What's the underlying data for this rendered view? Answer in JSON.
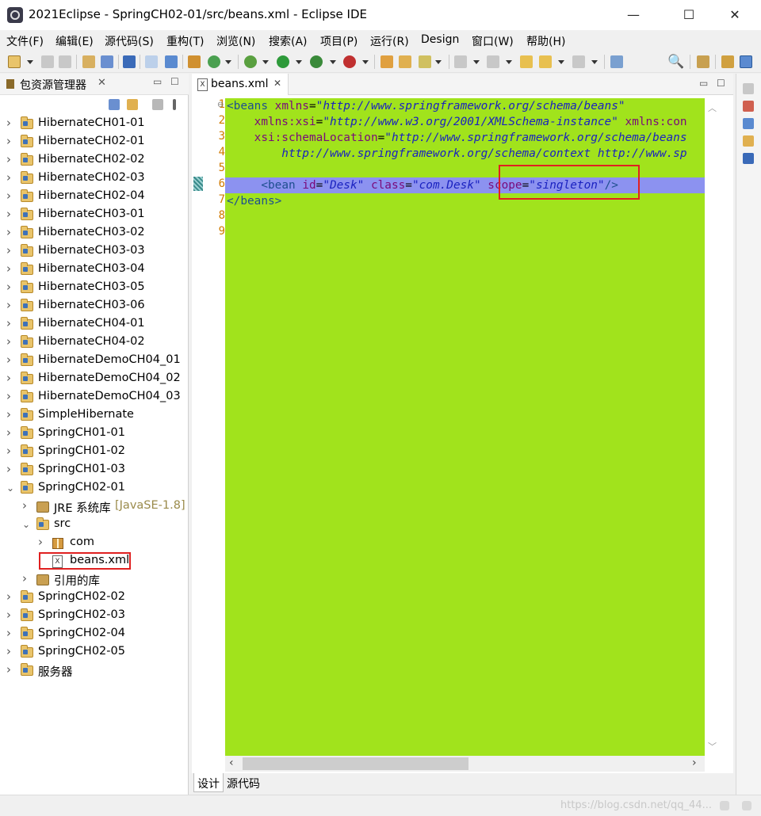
{
  "window": {
    "title": "2021Eclipse - SpringCH02-01/src/beans.xml - Eclipse IDE",
    "minimize": "—",
    "maximize": "☐",
    "close": "✕"
  },
  "menu": [
    "文件(F)",
    "编辑(E)",
    "源代码(S)",
    "重构(T)",
    "浏览(N)",
    "搜索(A)",
    "项目(P)",
    "运行(R)",
    "Design",
    "窗口(W)",
    "帮助(H)"
  ],
  "toolbar": {
    "icons": [
      "new-icon",
      "save-icon",
      "save-all-icon",
      "properties-icon",
      "console-icon",
      "skip-breakpoints-icon",
      "open-task-icon",
      "build-icon",
      "refresh-icon",
      "debug-icon",
      "run-icon",
      "coverage-icon",
      "external-tools-icon",
      "new-java-project-icon",
      "open-type-icon",
      "search-icon",
      "next-annotation-icon",
      "prev-annotation-icon",
      "last-edit-icon",
      "back-icon",
      "forward-icon",
      "pin-icon"
    ],
    "search_glyph": "🔍"
  },
  "explorer": {
    "title": "包资源管理器",
    "close_glyph": "✕",
    "minimize_glyph": "▭",
    "maximize_glyph": "☐",
    "items": [
      {
        "label": "HibernateCH01-01",
        "type": "project",
        "level": 0,
        "expanded": false
      },
      {
        "label": "HibernateCH02-01",
        "type": "project",
        "level": 0,
        "expanded": false
      },
      {
        "label": "HibernateCH02-02",
        "type": "project",
        "level": 0,
        "expanded": false
      },
      {
        "label": "HibernateCH02-03",
        "type": "project",
        "level": 0,
        "expanded": false
      },
      {
        "label": "HibernateCH02-04",
        "type": "project",
        "level": 0,
        "expanded": false
      },
      {
        "label": "HibernateCH03-01",
        "type": "project",
        "level": 0,
        "expanded": false
      },
      {
        "label": "HibernateCH03-02",
        "type": "project",
        "level": 0,
        "expanded": false
      },
      {
        "label": "HibernateCH03-03",
        "type": "project",
        "level": 0,
        "expanded": false
      },
      {
        "label": "HibernateCH03-04",
        "type": "project",
        "level": 0,
        "expanded": false
      },
      {
        "label": "HibernateCH03-05",
        "type": "project",
        "level": 0,
        "expanded": false
      },
      {
        "label": "HibernateCH03-06",
        "type": "project",
        "level": 0,
        "expanded": false
      },
      {
        "label": "HibernateCH04-01",
        "type": "project",
        "level": 0,
        "expanded": false
      },
      {
        "label": "HibernateCH04-02",
        "type": "project",
        "level": 0,
        "expanded": false
      },
      {
        "label": "HibernateDemoCH04_01",
        "type": "project",
        "level": 0,
        "expanded": false
      },
      {
        "label": "HibernateDemoCH04_02",
        "type": "project",
        "level": 0,
        "expanded": false
      },
      {
        "label": "HibernateDemoCH04_03",
        "type": "project",
        "level": 0,
        "expanded": false
      },
      {
        "label": "SimpleHibernate",
        "type": "project",
        "level": 0,
        "expanded": false
      },
      {
        "label": "SpringCH01-01",
        "type": "project",
        "level": 0,
        "expanded": false
      },
      {
        "label": "SpringCH01-02",
        "type": "project",
        "level": 0,
        "expanded": false
      },
      {
        "label": "SpringCH01-03",
        "type": "project",
        "level": 0,
        "expanded": false
      },
      {
        "label": "SpringCH02-01",
        "type": "project",
        "level": 0,
        "expanded": true
      },
      {
        "label": "JRE 系统库",
        "decoration": "[JavaSE-1.8]",
        "type": "library",
        "level": 1,
        "expanded": false
      },
      {
        "label": "src",
        "type": "srcfolder",
        "level": 1,
        "expanded": true
      },
      {
        "label": "com",
        "type": "package",
        "level": 2,
        "expanded": false
      },
      {
        "label": "beans.xml",
        "type": "xml",
        "level": 2,
        "highlighted": true
      },
      {
        "label": "引用的库",
        "type": "library",
        "level": 1,
        "expanded": false
      },
      {
        "label": "SpringCH02-02",
        "type": "project",
        "level": 0,
        "expanded": false
      },
      {
        "label": "SpringCH02-03",
        "type": "project",
        "level": 0,
        "expanded": false
      },
      {
        "label": "SpringCH02-04",
        "type": "project",
        "level": 0,
        "expanded": false
      },
      {
        "label": "SpringCH02-05",
        "type": "project",
        "level": 0,
        "expanded": false
      },
      {
        "label": "服务器",
        "type": "server",
        "level": 0,
        "expanded": false
      }
    ]
  },
  "editor": {
    "tab_label": "beans.xml",
    "tab_close": "✕",
    "bottom_tabs": [
      "设计",
      "源代码"
    ],
    "active_bottom_tab": 0,
    "background": "#a1e31c",
    "highlight_line_color": "#8c92f0",
    "current_line": 6,
    "lines": [
      [
        {
          "t": "tag",
          "s": "<beans "
        },
        {
          "t": "attr",
          "s": "xmlns"
        },
        {
          "t": "plain",
          "s": "="
        },
        {
          "t": "val",
          "s": "\"http://www.springframework.org/schema/beans\""
        }
      ],
      [
        {
          "t": "plain",
          "s": "    "
        },
        {
          "t": "attr",
          "s": "xmlns:xsi"
        },
        {
          "t": "plain",
          "s": "="
        },
        {
          "t": "val",
          "s": "\"http://www.w3.org/2001/XMLSchema-instance\""
        },
        {
          "t": "plain",
          "s": " "
        },
        {
          "t": "attr",
          "s": "xmlns:con"
        }
      ],
      [
        {
          "t": "plain",
          "s": "    "
        },
        {
          "t": "attr",
          "s": "xsi:schemaLocation"
        },
        {
          "t": "plain",
          "s": "="
        },
        {
          "t": "val",
          "s": "\"http://www.springframework.org/schema/beans"
        }
      ],
      [
        {
          "t": "val",
          "s": "        http://www.springframework.org/schema/context http://www.sp"
        }
      ],
      [],
      [
        {
          "t": "plain",
          "s": "     "
        },
        {
          "t": "tag",
          "s": "<bean "
        },
        {
          "t": "attr",
          "s": "id"
        },
        {
          "t": "plain",
          "s": "="
        },
        {
          "t": "val",
          "s": "\"Desk\""
        },
        {
          "t": "plain",
          "s": " "
        },
        {
          "t": "attr",
          "s": "class"
        },
        {
          "t": "plain",
          "s": "="
        },
        {
          "t": "val",
          "s": "\"com.Desk\""
        },
        {
          "t": "plain",
          "s": " "
        },
        {
          "t": "attr",
          "s": "scope"
        },
        {
          "t": "plain",
          "s": "="
        },
        {
          "t": "val",
          "s": "\"singleton\""
        },
        {
          "t": "tag",
          "s": "/>"
        }
      ],
      [
        {
          "t": "tag",
          "s": "</beans>"
        }
      ],
      [],
      []
    ]
  },
  "status": {
    "watermark": "https://blog.csdn.net/qq_44..."
  }
}
